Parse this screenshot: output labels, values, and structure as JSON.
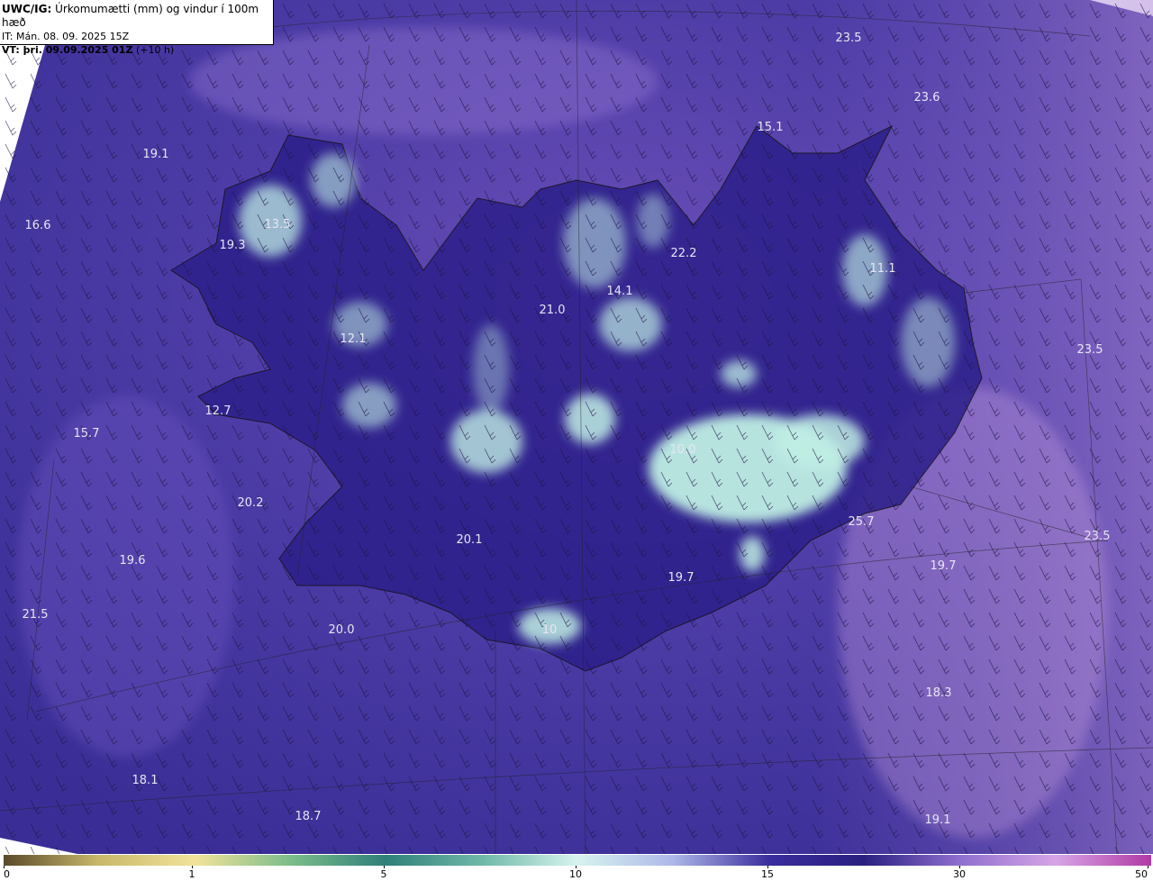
{
  "header": {
    "product": "UWC/IG:",
    "title": "Úrkomumætti (mm) og vindur í 100m hæð",
    "initial_time": "IT: Mán. 08. 09. 2025 15Z",
    "valid_label": "VT: þri. 09.09.2025 01Z",
    "lead": "(+10 h)"
  },
  "map": {
    "background_color": "#4b3aa6",
    "land_color": "#2c1f8a",
    "high_moisture_color": "#bfeee4",
    "value_labels": [
      {
        "text": "23.5"
      },
      {
        "text": "23.6"
      },
      {
        "text": "15.1"
      },
      {
        "text": "19.1"
      },
      {
        "text": "16.6"
      },
      {
        "text": "13.5"
      },
      {
        "text": "19.3"
      },
      {
        "text": "22.2"
      },
      {
        "text": "11.1"
      },
      {
        "text": "14.1"
      },
      {
        "text": "21.0"
      },
      {
        "text": "12.1"
      },
      {
        "text": "23.5"
      },
      {
        "text": "12.7"
      },
      {
        "text": "15.7"
      },
      {
        "text": "10.0"
      },
      {
        "text": "20.2"
      },
      {
        "text": "25.7"
      },
      {
        "text": "23.5"
      },
      {
        "text": "20.1"
      },
      {
        "text": "19.6"
      },
      {
        "text": "19.7"
      },
      {
        "text": "21.5"
      },
      {
        "text": "19.7"
      },
      {
        "text": "20.0"
      },
      {
        "text": "10"
      },
      {
        "text": "18.3"
      },
      {
        "text": "18.1"
      },
      {
        "text": "18.7"
      },
      {
        "text": "19.1"
      }
    ]
  },
  "colorbar": {
    "ticks": [
      "0",
      "1",
      "5",
      "10",
      "15",
      "30",
      "50"
    ],
    "colors": [
      "#5a4a2a",
      "#c9b86a",
      "#f1e39a",
      "#7bbd8a",
      "#2f7f7a",
      "#6fb9a8",
      "#d7f3ef",
      "#aeb8e8",
      "#3a2d9e",
      "#2a1f80",
      "#8f6fcf",
      "#d7a4e6",
      "#b13aa5"
    ]
  }
}
